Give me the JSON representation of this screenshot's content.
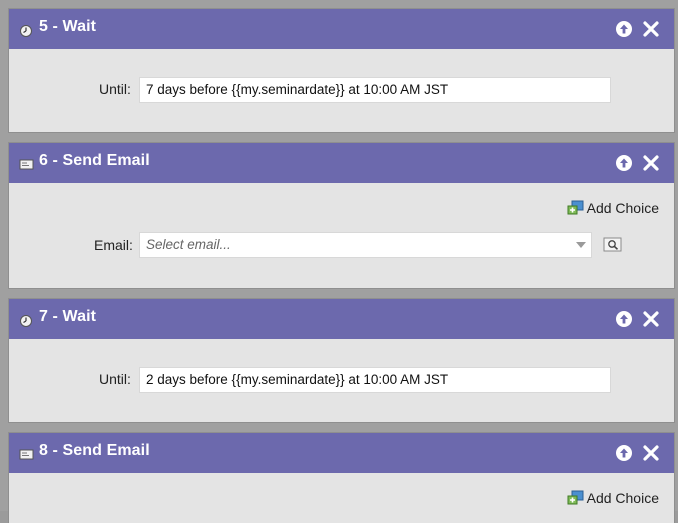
{
  "steps": [
    {
      "title": "5 - Wait",
      "icon": "clock-icon",
      "until_label": "Until:",
      "until_value": "7 days before {{my.seminardate}} at 10:00 AM JST"
    },
    {
      "title": "6 - Send Email",
      "icon": "email-icon",
      "add_choice_label": "Add Choice",
      "email_label": "Email:",
      "email_placeholder": "Select email..."
    },
    {
      "title": "7 - Wait",
      "icon": "clock-icon",
      "until_label": "Until:",
      "until_value": "2 days before {{my.seminardate}} at 10:00 AM JST"
    },
    {
      "title": "8 - Send Email",
      "icon": "email-icon",
      "add_choice_label": "Add Choice"
    }
  ],
  "colors": {
    "header": "#6c69ad",
    "body": "#e4e4e4",
    "background": "#a0a0a0"
  }
}
